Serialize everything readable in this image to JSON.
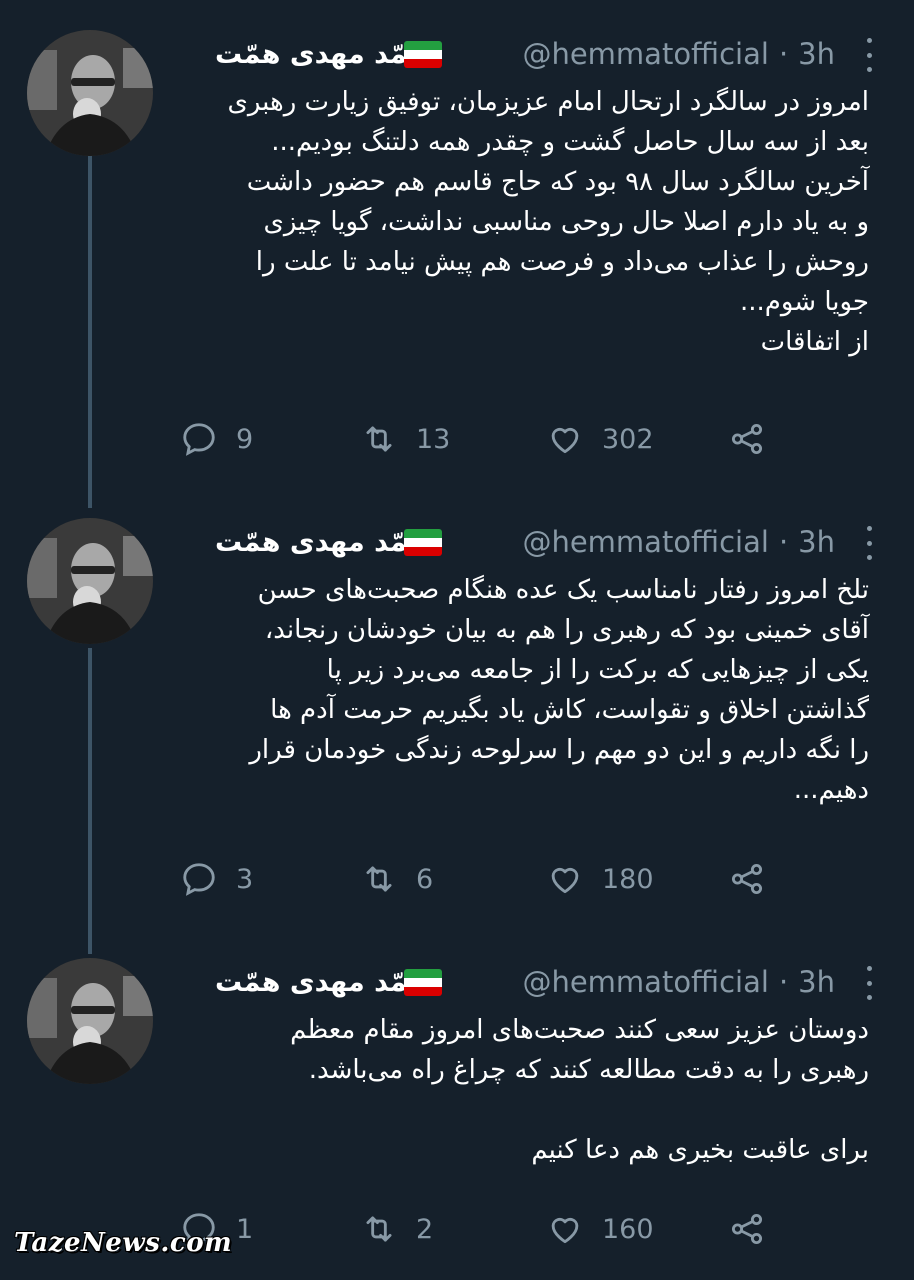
{
  "tweets": [
    {
      "name": "محمّد مهدی همّت",
      "handle": "@hemmatofficial",
      "dot": "·",
      "time": "3h",
      "lines": [
        "امروز در سالگرد ارتحال امام عزیزمان، توفیق زیارت رهبری",
        "بعد از سه سال حاصل گشت و چقدر همه دلتنگ بودیم...",
        "آخرین سالگرد سال ۹۸ بود که حاج قاسم هم حضور داشت",
        "و به یاد دارم اصلا حال روحی مناسبی نداشت، گویا چیزی",
        "روحش را عذاب می‌داد و فرصت هم پیش نیامد تا علت را",
        "جویا شوم...",
        "از اتفاقات"
      ],
      "replies": "9",
      "retweets": "13",
      "likes": "302"
    },
    {
      "name": "محمّد مهدی همّت",
      "handle": "@hemmatofficial",
      "dot": "·",
      "time": "3h",
      "lines": [
        "تلخ امروز رفتار نامناسب یک عده هنگام صحبت‌های حسن",
        "آقای خمینی بود که رهبری را هم به بیان خودشان رنجاند،",
        "یکی از چیزهایی که برکت را از جامعه می‌برد زیر پا",
        "گذاشتن اخلاق و تقواست، کاش یاد بگیریم حرمت آدم ها",
        "را نگه داریم و این دو مهم را سرلوحه زندگی خودمان قرار",
        "دهیم..."
      ],
      "replies": "3",
      "retweets": "6",
      "likes": "180"
    },
    {
      "name": "محمّد مهدی همّت",
      "handle": "@hemmatofficial",
      "dot": "·",
      "time": "3h",
      "lines": [
        "دوستان عزیز سعی کنند صحبت‌های امروز مقام معظم",
        "رهبری را به دقت مطالعه کنند که چراغ راه می‌باشد.",
        "",
        "برای عاقبت بخیری هم دعا کنیم"
      ],
      "replies": "1",
      "retweets": "2",
      "likes": "160"
    }
  ],
  "icons": {
    "reply": "reply-icon",
    "retweet": "retweet-icon",
    "like": "heart-icon",
    "share": "share-icon",
    "more": "more-vertical-icon",
    "flag": "iran-flag-icon"
  },
  "colors": {
    "background": "#15202b",
    "text": "#ffffff",
    "muted": "#8899a6",
    "thread_line": "#3d5466"
  },
  "watermark": "TazeNews.com"
}
